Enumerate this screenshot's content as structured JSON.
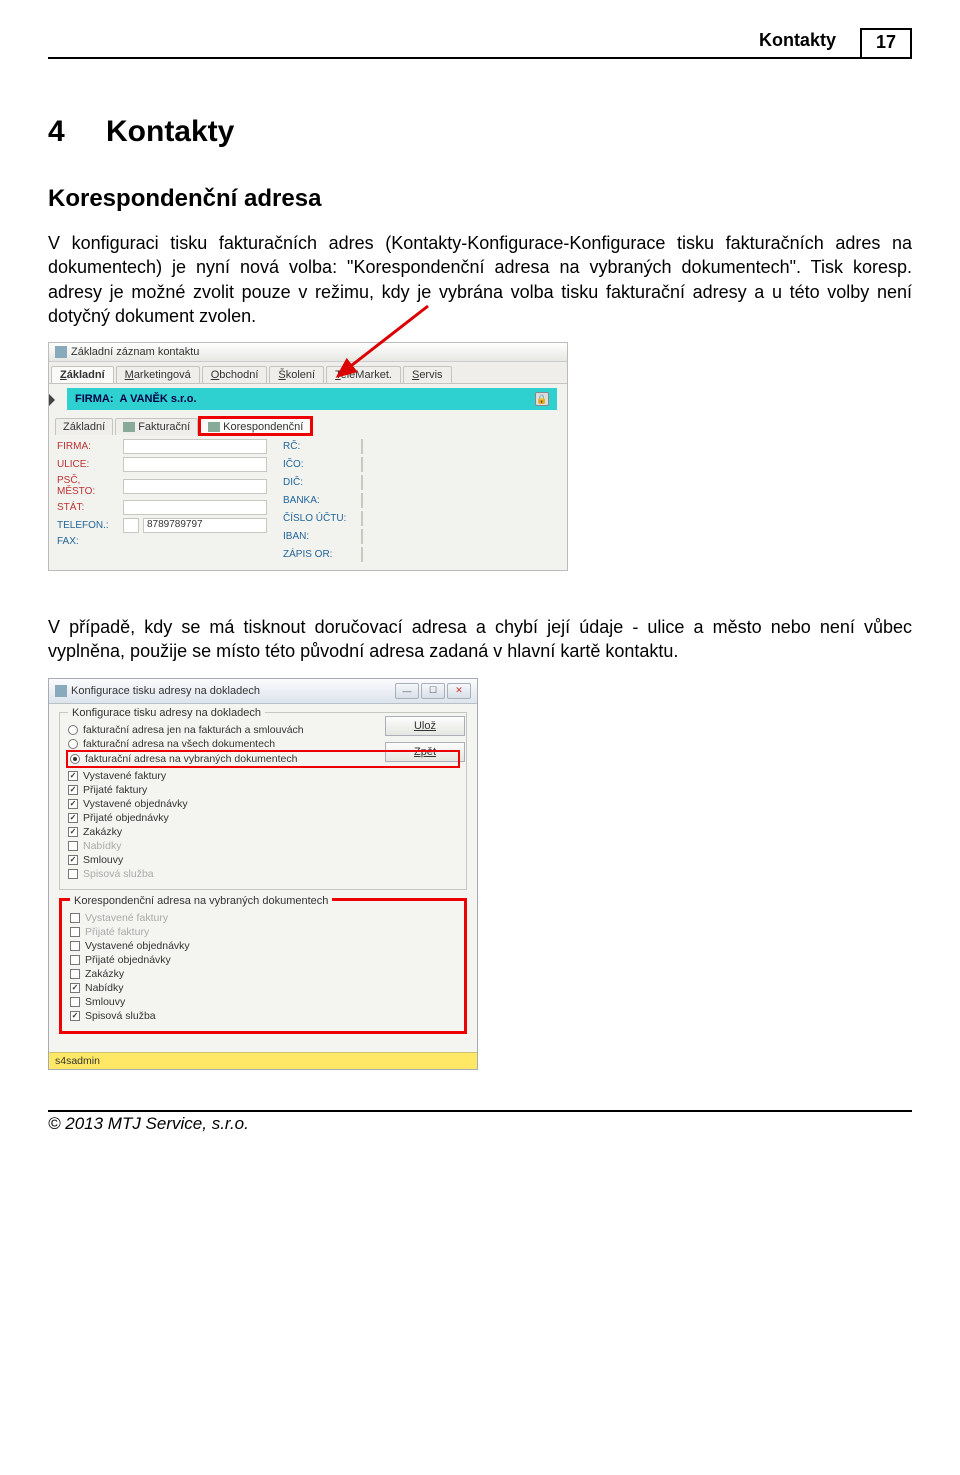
{
  "header": {
    "title": "Kontakty",
    "pagenum": "17"
  },
  "chapter": {
    "num": "4",
    "title": "Kontakty"
  },
  "subheading": "Korespondenční adresa",
  "para1": "V konfiguraci tisku fakturačních adres (Kontakty-Konfigurace-Konfigurace tisku fakturačních adres na dokumentech) je nyní nová volba: \"Korespondenční adresa na vybraných dokumentech\". Tisk koresp. adresy je možné zvolit pouze v režimu, kdy je vybrána volba tisku fakturační adresy a u této volby není dotyčný dokument zvolen.",
  "para2": "V případě, kdy se má tisknout doručovací adresa a chybí její údaje - ulice a město nebo není vůbec vyplněna, použije se místo této původní adresa zadaná v hlavní kartě kontaktu.",
  "shot1": {
    "windowTitle": "Základní záznam kontaktu",
    "topTabs": [
      "Základní",
      "Marketingová",
      "Obchodní",
      "Školení",
      "TeleMarket.",
      "Servis"
    ],
    "firmaLabel": "FIRMA:",
    "firmaValue": "A VANĚK s.r.o.",
    "midTabs": [
      "Základní",
      "Fakturační",
      "Korespondenční"
    ],
    "leftFields": [
      "FIRMA:",
      "ULICE:",
      "PSČ, MĚSTO:",
      "STÁT:"
    ],
    "leftBlue": "TELEFON.:",
    "telValue": "8789789797",
    "leftFax": "FAX:",
    "rightFields": [
      "RČ:",
      "IČO:",
      "DIČ:",
      "BANKA:",
      "ČÍSLO ÚČTU:",
      "IBAN:",
      "ZÁPIS OR:"
    ]
  },
  "shot2": {
    "windowTitle": "Konfigurace tisku adresy na dokladech",
    "group1Title": "Konfigurace tisku adresy na dokladech",
    "radios": [
      {
        "label": "fakturační adresa jen na fakturách a smlouvách",
        "on": false
      },
      {
        "label": "fakturační adresa na všech dokumentech",
        "on": false
      },
      {
        "label": "fakturační adresa na vybraných dokumentech",
        "on": true,
        "red": true
      }
    ],
    "checks1": [
      {
        "label": "Vystavené faktury",
        "on": true
      },
      {
        "label": "Přijaté faktury",
        "on": true
      },
      {
        "label": "Vystavené objednávky",
        "on": true
      },
      {
        "label": "Přijaté objednávky",
        "on": true
      },
      {
        "label": "Zakázky",
        "on": true
      },
      {
        "label": "Nabídky",
        "on": false,
        "dim": true
      },
      {
        "label": "Smlouvy",
        "on": true
      },
      {
        "label": "Spisová služba",
        "on": false,
        "dim": true
      }
    ],
    "btnSave": "Ulož",
    "btnBack": "Zpět",
    "group2Title": "Korespondenční adresa na vybraných dokumentech",
    "checks2": [
      {
        "label": "Vystavené faktury",
        "on": false,
        "dim": true
      },
      {
        "label": "Přijaté faktury",
        "on": false,
        "dim": true
      },
      {
        "label": "Vystavené objednávky",
        "on": false
      },
      {
        "label": "Přijaté objednávky",
        "on": false
      },
      {
        "label": "Zakázky",
        "on": false
      },
      {
        "label": "Nabídky",
        "on": true
      },
      {
        "label": "Smlouvy",
        "on": false
      },
      {
        "label": "Spisová služba",
        "on": true
      }
    ],
    "status": "s4sadmin"
  },
  "footer": "© 2013 MTJ Service, s.r.o."
}
